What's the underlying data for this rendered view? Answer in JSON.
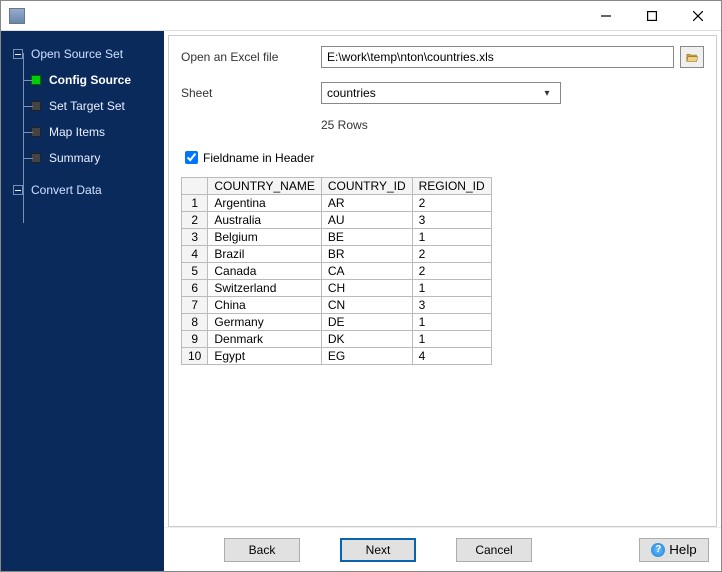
{
  "window": {
    "title": ""
  },
  "sidebar": {
    "root1": "Open Source Set",
    "children": [
      {
        "label": "Config Source",
        "active": true
      },
      {
        "label": "Set Target Set",
        "active": false
      },
      {
        "label": "Map Items",
        "active": false
      },
      {
        "label": "Summary",
        "active": false
      }
    ],
    "root2": "Convert Data"
  },
  "form": {
    "file_label": "Open an Excel file",
    "file_value": "E:\\work\\temp\\nton\\countries.xls",
    "sheet_label": "Sheet",
    "sheet_value": "countries",
    "rowcount": "25 Rows",
    "checkbox_label": "Fieldname in Header",
    "checkbox_checked": true
  },
  "table": {
    "headers": [
      "COUNTRY_NAME",
      "COUNTRY_ID",
      "REGION_ID"
    ],
    "rows": [
      [
        "1",
        "Argentina",
        "AR",
        "2"
      ],
      [
        "2",
        "Australia",
        "AU",
        "3"
      ],
      [
        "3",
        "Belgium",
        "BE",
        "1"
      ],
      [
        "4",
        "Brazil",
        "BR",
        "2"
      ],
      [
        "5",
        "Canada",
        "CA",
        "2"
      ],
      [
        "6",
        "Switzerland",
        "CH",
        "1"
      ],
      [
        "7",
        "China",
        "CN",
        "3"
      ],
      [
        "8",
        "Germany",
        "DE",
        "1"
      ],
      [
        "9",
        "Denmark",
        "DK",
        "1"
      ],
      [
        "10",
        "Egypt",
        "EG",
        "4"
      ]
    ]
  },
  "footer": {
    "back": "Back",
    "next": "Next",
    "cancel": "Cancel",
    "help": "Help"
  }
}
